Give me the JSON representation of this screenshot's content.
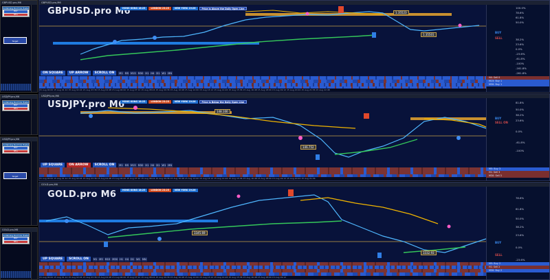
{
  "mini_windows": [
    {
      "title": "GBPUSD.pro,M6",
      "panel_header": "Combining Don't Do Trader",
      "rows": [
        "BUY",
        "SELL"
      ],
      "target": "Target"
    },
    {
      "title": "USDJPY.pro,M6",
      "panel_header": "Combining Don't Do Trader",
      "rows": [
        "BUY",
        "SELL"
      ],
      "target": "Target"
    },
    {
      "title": "USDJPY.pro,M6",
      "panel_header": "Combining Don't Do Trader",
      "rows": [
        "BUY",
        "SELL"
      ],
      "target": "Target"
    },
    {
      "title": "GOLD.pro,M6",
      "panel_header": "Combining Don't Do Trader",
      "rows": [
        "BUY",
        "SELL"
      ],
      "target": "Target"
    }
  ],
  "charts": [
    {
      "window_title": "GBPUSD.pro,M6",
      "symbol": "GBPUSD.pro M6",
      "sessions": [
        "HONG KONG 18:25",
        "LONDON 23:25",
        "NEW YORK 19:26"
      ],
      "message": "Price is Above the Daily Open Line",
      "price_tag": "1.35523",
      "lower_tag": "1.35501",
      "buttons": {
        "square": "ON SQUARE",
        "arrow": "UP ARROW",
        "scroll": "SCROLL ON"
      },
      "timeframes": [
        "M1",
        "M5",
        "M15",
        "M30",
        "H1",
        "H4",
        "D1",
        "W1",
        "MN"
      ],
      "y_labels": [
        "100.0%",
        "78.6%",
        "61.8%",
        "50.0%",
        "38.2%",
        "23.6%",
        "0.0%",
        "-23.6%",
        "-61.8%",
        "-100%",
        "-161.8%",
        "-261.8%"
      ],
      "signals": {
        "buy": "BUY",
        "sell": "SELL"
      },
      "status": [
        "H4: Sell 0",
        "M15: Buy 1",
        "M30: Buy 1"
      ],
      "x_labels": "15 Aug 00:00   15 Aug 01:12   15 Aug 02:24   15 Aug 03:36   15 Aug 04:48   15 Aug 06:00   15 Aug 07:12   15 Aug 08:24   15 Aug 09:36   15 Aug 10:48   15 Aug 12:00   15 Aug 13:12   15 Aug 14:24   15 Aug 15:36   15 Aug 16:48   15 Aug 18:00   15 Aug 19:12   15 Aug 20:24   15 Aug 21:36   15 Aug 22:48"
    },
    {
      "window_title": "USDJPY.pro,M6",
      "symbol": "USDJPY.pro M6",
      "sessions": [
        "HONG KONG 18:25",
        "LONDON 23:25",
        "NEW YORK 19:26"
      ],
      "message": "Price is Below the Daily Open Line",
      "price_tag": "148.100",
      "lower_tag": "146.752",
      "buttons": {
        "square": "UP SQUARE",
        "arrow": "ON ARROW",
        "scroll": "SCROLL ON"
      },
      "timeframes": [
        "M1",
        "M5",
        "M15",
        "M30",
        "H1",
        "H4",
        "D1",
        "W1",
        "MN"
      ],
      "y_labels": [
        "81.8%",
        "50.0%",
        "38.2%",
        "23.6%",
        "0.0%",
        "-61.8%",
        "-100%"
      ],
      "signals": {
        "buy": "BUY",
        "sell": "SELL ON"
      },
      "status": [
        "M5: Buy 3",
        "H1: Sell 3",
        "M30: Sell 3"
      ],
      "x_labels": "15 Aug 00:00   15 Aug 01:12   15 Aug 02:24   15 Aug 03:36   15 Aug 04:48   15 Aug 06:00   15 Aug 07:12   15 Aug 08:24   15 Aug 09:36   15 Aug 10:48   15 Aug 12:00   15 Aug 13:12   15 Aug 14:24   15 Aug 15:36   15 Aug 16:48   15 Aug 18:00   15 Aug 19:12   15 Aug 20:24   15 Aug 21:36"
    },
    {
      "window_title": "GOLD.pro,M6",
      "symbol": "GOLD.pro M6",
      "sessions": [
        "HONG KONG 18:25",
        "LONDON 23:25",
        "NEW YORK 19:26"
      ],
      "message": "",
      "price_tag": "3345.69",
      "lower_tag": "3332.93",
      "buttons": {
        "square": "UP SQUARE",
        "arrow": "",
        "scroll": "SCROLL ON"
      },
      "timeframes": [
        "M1",
        "M5",
        "M15",
        "M30",
        "H1",
        "H4",
        "D1",
        "W1",
        "MN"
      ],
      "y_labels": [
        "78.6%",
        "61.8%",
        "50.0%",
        "38.2%",
        "23.6%",
        "0.0%",
        "-23.6%"
      ],
      "signals": {
        "buy": "BUY",
        "sell": "SELL"
      },
      "status": [
        "M5: Buy 2",
        "H1: Sell 2",
        "M30: Buy 2"
      ],
      "x_labels": "15 Aug 00:00   15 Aug 01:12   15 Aug 02:24   15 Aug 03:36   15 Aug 04:48   15 Aug 06:00   15 Aug 07:12   15 Aug 08:24   15 Aug 09:36   15 Aug 10:48   15 Aug 12:00   15 Aug 13:12   15 Aug 14:24   15 Aug 15:36   15 Aug 16:48   15 Aug 18:00   15 Aug 19:12"
    }
  ]
}
